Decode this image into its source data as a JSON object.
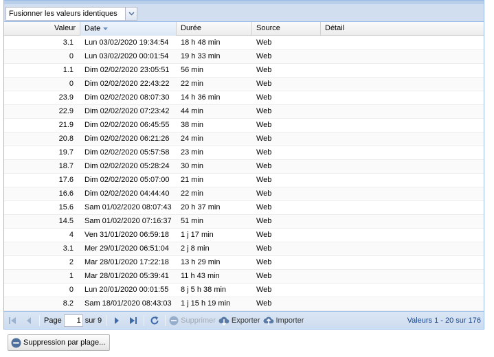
{
  "toolbar": {
    "merge_select": "Fusionner les valeurs identiques"
  },
  "columns": {
    "valeur": "Valeur",
    "date": "Date",
    "duree": "Durée",
    "source": "Source",
    "detail": "Détail"
  },
  "rows": [
    {
      "valeur": "3.1",
      "date": "Lun 03/02/2020 19:34:54",
      "duree": "18 h 48 min",
      "source": "Web",
      "detail": ""
    },
    {
      "valeur": "0",
      "date": "Lun 03/02/2020 00:01:54",
      "duree": "19 h 33 min",
      "source": "Web",
      "detail": ""
    },
    {
      "valeur": "1.1",
      "date": "Dim 02/02/2020 23:05:51",
      "duree": "56 min",
      "source": "Web",
      "detail": ""
    },
    {
      "valeur": "0",
      "date": "Dim 02/02/2020 22:43:22",
      "duree": "22 min",
      "source": "Web",
      "detail": ""
    },
    {
      "valeur": "23.9",
      "date": "Dim 02/02/2020 08:07:30",
      "duree": "14 h 36 min",
      "source": "Web",
      "detail": ""
    },
    {
      "valeur": "22.9",
      "date": "Dim 02/02/2020 07:23:42",
      "duree": "44 min",
      "source": "Web",
      "detail": ""
    },
    {
      "valeur": "21.9",
      "date": "Dim 02/02/2020 06:45:55",
      "duree": "38 min",
      "source": "Web",
      "detail": ""
    },
    {
      "valeur": "20.8",
      "date": "Dim 02/02/2020 06:21:26",
      "duree": "24 min",
      "source": "Web",
      "detail": ""
    },
    {
      "valeur": "19.7",
      "date": "Dim 02/02/2020 05:57:58",
      "duree": "23 min",
      "source": "Web",
      "detail": ""
    },
    {
      "valeur": "18.7",
      "date": "Dim 02/02/2020 05:28:24",
      "duree": "30 min",
      "source": "Web",
      "detail": ""
    },
    {
      "valeur": "17.6",
      "date": "Dim 02/02/2020 05:07:00",
      "duree": "21 min",
      "source": "Web",
      "detail": ""
    },
    {
      "valeur": "16.6",
      "date": "Dim 02/02/2020 04:44:40",
      "duree": "22 min",
      "source": "Web",
      "detail": ""
    },
    {
      "valeur": "15.6",
      "date": "Sam 01/02/2020 08:07:43",
      "duree": "20 h 37 min",
      "source": "Web",
      "detail": ""
    },
    {
      "valeur": "14.5",
      "date": "Sam 01/02/2020 07:16:37",
      "duree": "51 min",
      "source": "Web",
      "detail": ""
    },
    {
      "valeur": "4",
      "date": "Ven 31/01/2020 06:59:18",
      "duree": "1 j 17 min",
      "source": "Web",
      "detail": ""
    },
    {
      "valeur": "3.1",
      "date": "Mer 29/01/2020 06:51:04",
      "duree": "2 j 8 min",
      "source": "Web",
      "detail": ""
    },
    {
      "valeur": "2",
      "date": "Mar 28/01/2020 17:22:18",
      "duree": "13 h 29 min",
      "source": "Web",
      "detail": ""
    },
    {
      "valeur": "1",
      "date": "Mar 28/01/2020 05:39:41",
      "duree": "11 h 43 min",
      "source": "Web",
      "detail": ""
    },
    {
      "valeur": "0",
      "date": "Lun 20/01/2020 00:01:55",
      "duree": "8 j 5 h 38 min",
      "source": "Web",
      "detail": ""
    },
    {
      "valeur": "8.2",
      "date": "Sam 18/01/2020 08:43:03",
      "duree": "1 j 15 h 19 min",
      "source": "Web",
      "detail": ""
    }
  ],
  "paging": {
    "page_label": "Page",
    "page_value": "1",
    "of_label": "sur 9",
    "delete_label": "Supprimer",
    "export_label": "Exporter",
    "import_label": "Importer",
    "info": "Valeurs 1 - 20 sur 176"
  },
  "footer": {
    "range_delete_label": "Suppression par plage..."
  },
  "colors": {
    "accent": "#99bbe8",
    "toolbar": "#d0def0",
    "info_text": "#15428b"
  }
}
